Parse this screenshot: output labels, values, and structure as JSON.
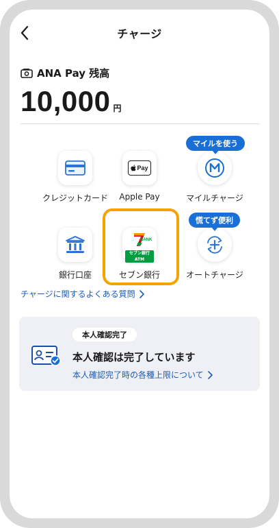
{
  "header": {
    "title": "チャージ"
  },
  "balance": {
    "label": "ANA Pay 残高",
    "amount": "10,000",
    "unit": "円"
  },
  "options": [
    {
      "id": "credit-card",
      "label": "クレジットカード",
      "icon": "credit-card-icon"
    },
    {
      "id": "apple-pay",
      "label": "Apple Pay",
      "icon": "apple-pay-icon",
      "icon_text": "Pay"
    },
    {
      "id": "mile-charge",
      "label": "マイルチャージ",
      "icon": "mile-m-icon",
      "badge": "マイルを使う"
    },
    {
      "id": "bank-account",
      "label": "銀行口座",
      "icon": "bank-icon"
    },
    {
      "id": "seven-bank",
      "label": "セブン銀行",
      "icon": "seven-bank-atm-icon",
      "icon_text_top": "BANK",
      "icon_text_bottom": "セブン銀行ATM",
      "highlighted": true
    },
    {
      "id": "auto-charge",
      "label": "オートチャージ",
      "icon": "auto-charge-icon",
      "badge": "慌てず便利"
    }
  ],
  "faq": {
    "label": "チャージに関するよくある質問"
  },
  "verification": {
    "badge": "本人確認完了",
    "title": "本人確認は完了しています",
    "link": "本人確認完了時の各種上限について"
  },
  "colors": {
    "accent": "#1a6fd6",
    "link": "#1e5bb8",
    "highlight": "#f5a300"
  }
}
